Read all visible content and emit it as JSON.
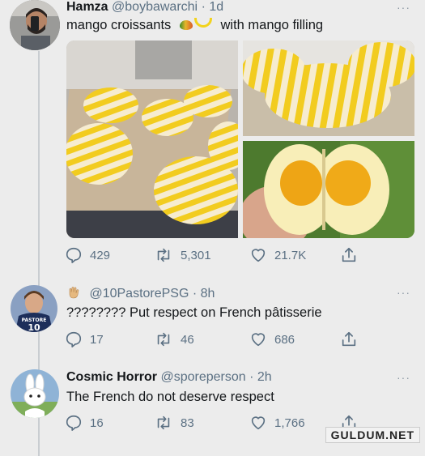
{
  "tweets": [
    {
      "name": "Hamza",
      "handle": "@boybawarchi",
      "time": "· 1d",
      "text_before": "mango croissants",
      "emoji": [
        "mango-emoji",
        "banana-emoji"
      ],
      "text_after": "with mango filling",
      "stats": {
        "replies": "429",
        "retweets": "5,301",
        "likes": "21.7K"
      }
    },
    {
      "name_emoji": "waving-hand-emoji",
      "handle": "@10PastorePSG",
      "time": "· 8h",
      "text": "???????? Put respect on French pâtisserie",
      "stats": {
        "replies": "17",
        "retweets": "46",
        "likes": "686"
      }
    },
    {
      "name": "Cosmic Horror",
      "handle": "@sporeperson",
      "time": "· 2h",
      "text": "The French do not deserve respect",
      "stats": {
        "replies": "16",
        "retweets": "83",
        "likes": "1,766"
      }
    }
  ],
  "more_label": "···",
  "jersey_text": {
    "name": "PASTORE",
    "number": "10"
  },
  "watermark": "GULDUM.NET",
  "colors": {
    "croissant_yellow": "#f2cc1f",
    "croissant_cream": "#f6ecd0",
    "muted": "#5b7083",
    "thread_line": "#c9cdd1"
  }
}
